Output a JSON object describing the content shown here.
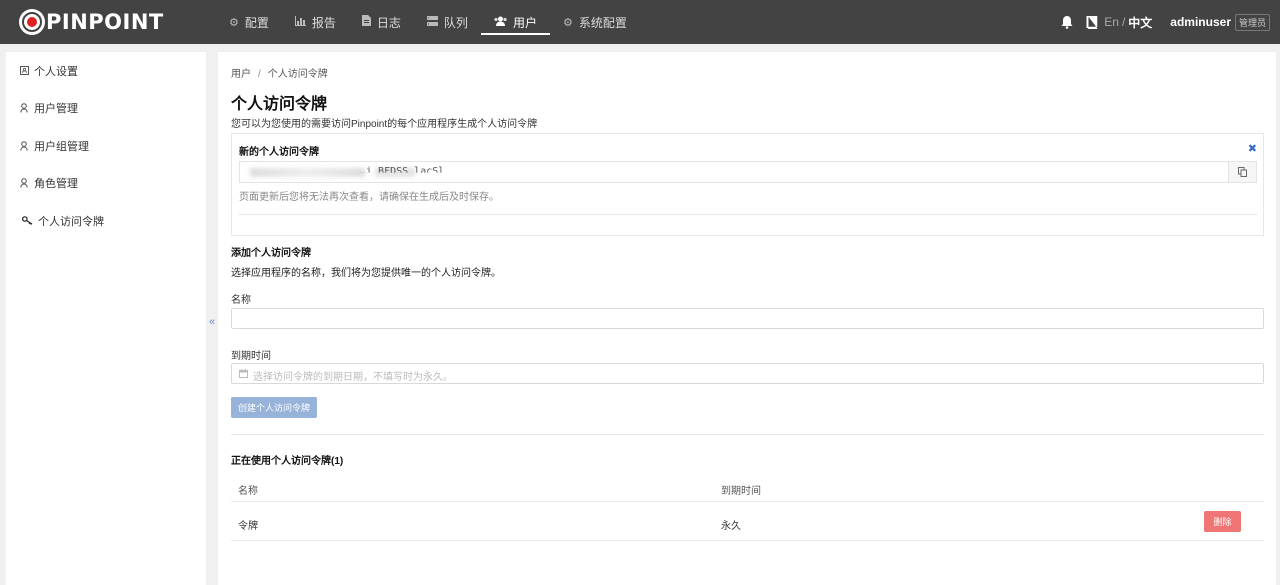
{
  "app": {
    "logo_text": "PINPOINT"
  },
  "nav": {
    "items": [
      {
        "label": "配置",
        "icon": "gear-icon"
      },
      {
        "label": "报告",
        "icon": "bar-chart-icon"
      },
      {
        "label": "日志",
        "icon": "file-icon"
      },
      {
        "label": "队列",
        "icon": "server-icon"
      },
      {
        "label": "用户",
        "icon": "users-icon",
        "active": true
      },
      {
        "label": "系统配置",
        "icon": "gear-icon"
      }
    ]
  },
  "header": {
    "lang_en": "En",
    "lang_sep": "/",
    "lang_zh": "中文",
    "username": "adminuser",
    "role": "管理员"
  },
  "sidebar": {
    "items": [
      {
        "label": "个人设置",
        "icon": "id-card-icon"
      },
      {
        "label": "用户管理",
        "icon": "user-icon"
      },
      {
        "label": "用户组管理",
        "icon": "user-icon"
      },
      {
        "label": "角色管理",
        "icon": "user-icon"
      },
      {
        "label": "个人访问令牌",
        "icon": "key-icon"
      }
    ],
    "collapse_glyph": "«"
  },
  "main": {
    "breadcrumb": [
      "用户",
      "个人访问令牌"
    ],
    "breadcrumb_sep": "/",
    "title": "个人访问令牌",
    "description": "您可以为您使用的需要访问Pinpoint的每个应用程序生成个人访问令牌",
    "new_token": {
      "title": "新的个人访问令牌",
      "close_glyph": "✖",
      "token_value": "…i BFDSS lacSl",
      "note": "页面更新后您将无法再次查看，请确保在生成后及时保存。"
    },
    "add": {
      "title": "添加个人访问令牌",
      "description": "选择应用程序的名称，我们将为您提供唯一的个人访问令牌。",
      "name_label": "名称",
      "name_value": "",
      "expiry_label": "到期时间",
      "expiry_placeholder": "选择访问令牌的到期日期，不填写时为永久。",
      "create_label": "创建个人访问令牌"
    },
    "active": {
      "title": "正在使用个人访问令牌(1)",
      "columns": [
        "名称",
        "到期时间"
      ],
      "rows": [
        {
          "name": "令牌",
          "expiry": "永久",
          "action": "删除"
        }
      ]
    }
  },
  "colors": {
    "topbar": "#434343",
    "primary_disabled": "#98b3d9",
    "danger": "#f07575",
    "link": "#3b6bc4"
  }
}
